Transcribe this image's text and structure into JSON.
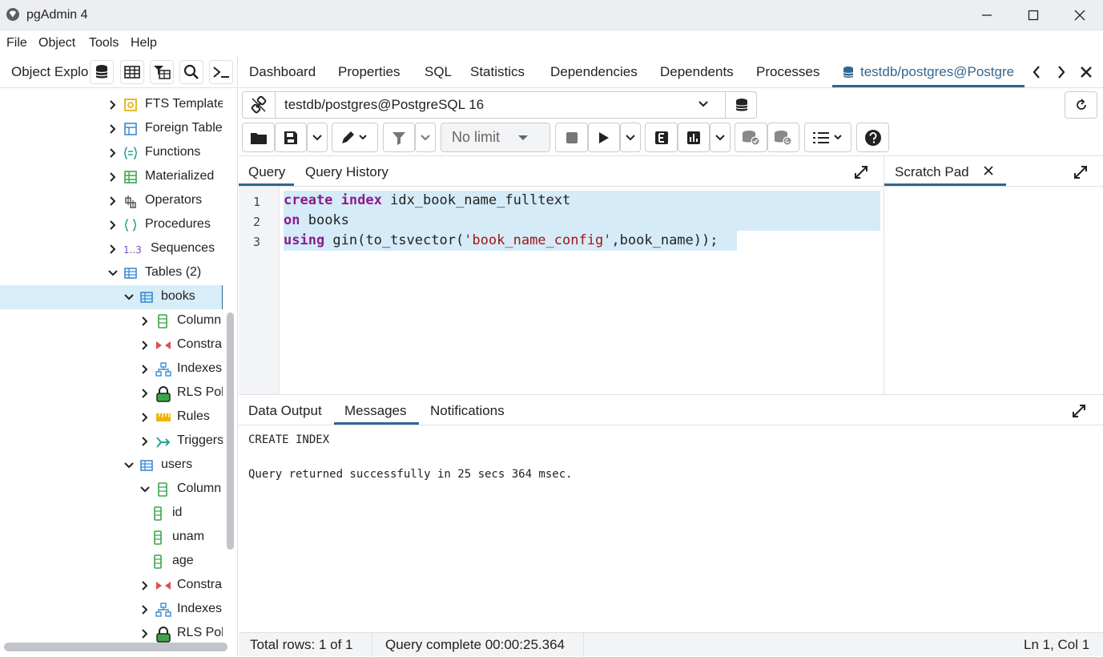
{
  "window": {
    "title": "pgAdmin 4"
  },
  "menu": {
    "items": [
      "File",
      "Object",
      "Tools",
      "Help"
    ]
  },
  "object_explorer": {
    "title": "Object Explo",
    "tree": [
      {
        "label": "FTS Template",
        "icon": "fts-template-icon",
        "indent": 0,
        "expanded": false
      },
      {
        "label": "Foreign Table",
        "icon": "foreign-table-icon",
        "indent": 0,
        "expanded": false
      },
      {
        "label": "Functions",
        "icon": "function-icon",
        "indent": 0,
        "expanded": false
      },
      {
        "label": "Materialized",
        "icon": "materialized-view-icon",
        "indent": 0,
        "expanded": false
      },
      {
        "label": "Operators",
        "icon": "operator-icon",
        "indent": 0,
        "expanded": false
      },
      {
        "label": "Procedures",
        "icon": "procedure-icon",
        "indent": 0,
        "expanded": false
      },
      {
        "label": "Sequences",
        "icon": "sequence-icon",
        "indent": 0,
        "expanded": false
      },
      {
        "label": "Tables (2)",
        "icon": "tables-icon",
        "indent": 0,
        "expanded": true
      },
      {
        "label": "books",
        "icon": "table-icon",
        "indent": 1,
        "expanded": true,
        "selected": true
      },
      {
        "label": "Column",
        "icon": "column-icon",
        "indent": 2,
        "expanded": false
      },
      {
        "label": "Constra",
        "icon": "constraint-icon",
        "indent": 2,
        "expanded": false
      },
      {
        "label": "Indexes",
        "icon": "index-icon",
        "indent": 2,
        "expanded": false
      },
      {
        "label": "RLS Pol",
        "icon": "rls-policy-icon",
        "indent": 2,
        "expanded": false
      },
      {
        "label": "Rules",
        "icon": "rule-icon",
        "indent": 2,
        "expanded": false
      },
      {
        "label": "Triggers",
        "icon": "trigger-icon",
        "indent": 2,
        "expanded": false
      },
      {
        "label": "users",
        "icon": "table-icon",
        "indent": 1,
        "expanded": true
      },
      {
        "label": "Column",
        "icon": "column-icon",
        "indent": 2,
        "expanded": true
      },
      {
        "label": "id",
        "icon": "column-leaf-icon",
        "indent": 3,
        "leaf": true
      },
      {
        "label": "unam",
        "icon": "column-leaf-icon",
        "indent": 3,
        "leaf": true
      },
      {
        "label": "age",
        "icon": "column-leaf-icon",
        "indent": 3,
        "leaf": true
      },
      {
        "label": "Constra",
        "icon": "constraint-icon",
        "indent": 2,
        "expanded": false
      },
      {
        "label": "Indexes",
        "icon": "index-icon",
        "indent": 2,
        "expanded": false
      },
      {
        "label": "RLS Pol",
        "icon": "rls-policy-icon",
        "indent": 2,
        "expanded": false
      }
    ]
  },
  "tabs": [
    "Dashboard",
    "Properties",
    "SQL",
    "Statistics",
    "Dependencies",
    "Dependents",
    "Processes"
  ],
  "active_tab": "testdb/postgres@Postgre",
  "connection": {
    "value": "testdb/postgres@PostgreSQL 16"
  },
  "toolbar": {
    "limit": "No limit"
  },
  "query_tabs": {
    "query": "Query",
    "history": "Query History",
    "scratch": "Scratch Pad"
  },
  "editor": {
    "line_numbers": [
      "1",
      "2",
      "3"
    ],
    "lines": [
      [
        {
          "t": "create",
          "c": "kw"
        },
        {
          "t": " "
        },
        {
          "t": "index",
          "c": "kw"
        },
        {
          "t": " idx_book_name_fulltext"
        }
      ],
      [
        {
          "t": "on",
          "c": "kw"
        },
        {
          "t": " books"
        }
      ],
      [
        {
          "t": "using",
          "c": "kw"
        },
        {
          "t": " gin(to_tsvector("
        },
        {
          "t": "'book_name_config'",
          "c": "str"
        },
        {
          "t": ",book_name));"
        }
      ]
    ]
  },
  "output_tabs": {
    "data": "Data Output",
    "messages": "Messages",
    "notifications": "Notifications"
  },
  "messages": {
    "line1": "CREATE INDEX",
    "line2": "Query returned successfully in 25 secs 364 msec."
  },
  "status": {
    "rows": "Total rows: 1 of 1",
    "complete": "Query complete 00:00:25.364",
    "position": "Ln 1, Col 1"
  },
  "colors": {
    "accent": "#326690",
    "selection": "#d7edf8",
    "keyword": "#8c1c8c",
    "string": "#a31515"
  }
}
